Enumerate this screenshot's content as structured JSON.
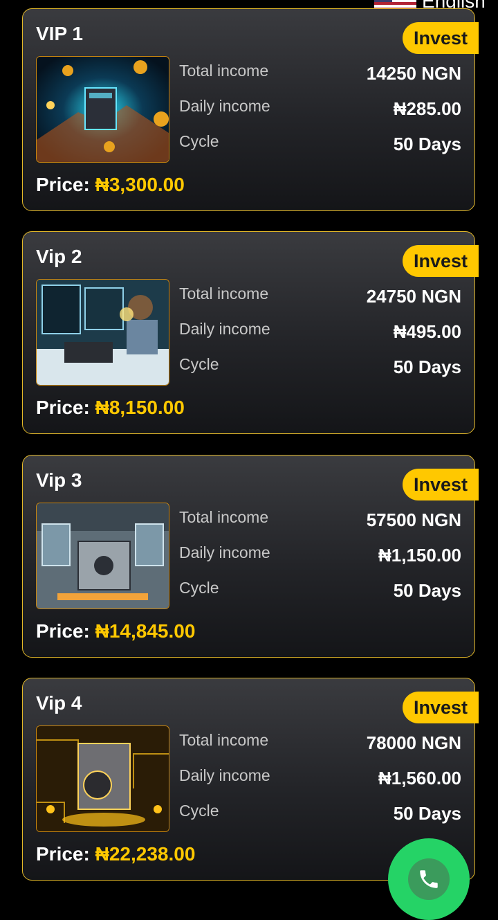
{
  "language": {
    "label": "English"
  },
  "plans": [
    {
      "name": "VIP 1",
      "invest_label": "Invest",
      "total_label": "Total income",
      "total_value": "14250 NGN",
      "daily_label": "Daily income",
      "daily_value": "₦285.00",
      "cycle_label": "Cycle",
      "cycle_value": "50 Days",
      "price_label": "Price:",
      "price_value": "₦3,300.00",
      "accent": "#19c3e0"
    },
    {
      "name": "Vip 2",
      "invest_label": "Invest",
      "total_label": "Total income",
      "total_value": "24750 NGN",
      "daily_label": "Daily income",
      "daily_value": "₦495.00",
      "cycle_label": "Cycle",
      "cycle_value": "50 Days",
      "price_label": "Price:",
      "price_value": "₦8,150.00",
      "accent": "#8fd0e8"
    },
    {
      "name": "Vip 3",
      "invest_label": "Invest",
      "total_label": "Total income",
      "total_value": "57500 NGN",
      "daily_label": "Daily income",
      "daily_value": "₦1,150.00",
      "cycle_label": "Cycle",
      "cycle_value": "50 Days",
      "price_label": "Price:",
      "price_value": "₦14,845.00",
      "accent": "#f2a33a"
    },
    {
      "name": "Vip 4",
      "invest_label": "Invest",
      "total_label": "Total income",
      "total_value": "78000 NGN",
      "daily_label": "Daily income",
      "daily_value": "₦1,560.00",
      "cycle_label": "Cycle",
      "cycle_value": "50 Days",
      "price_label": "Price:",
      "price_value": "₦22,238.00",
      "accent": "#ffc21a"
    }
  ],
  "colors": {
    "gold": "#ffc800",
    "border": "#e2b829",
    "whatsapp": "#25d366"
  },
  "whatsapp": {
    "icon": "phone-icon"
  }
}
